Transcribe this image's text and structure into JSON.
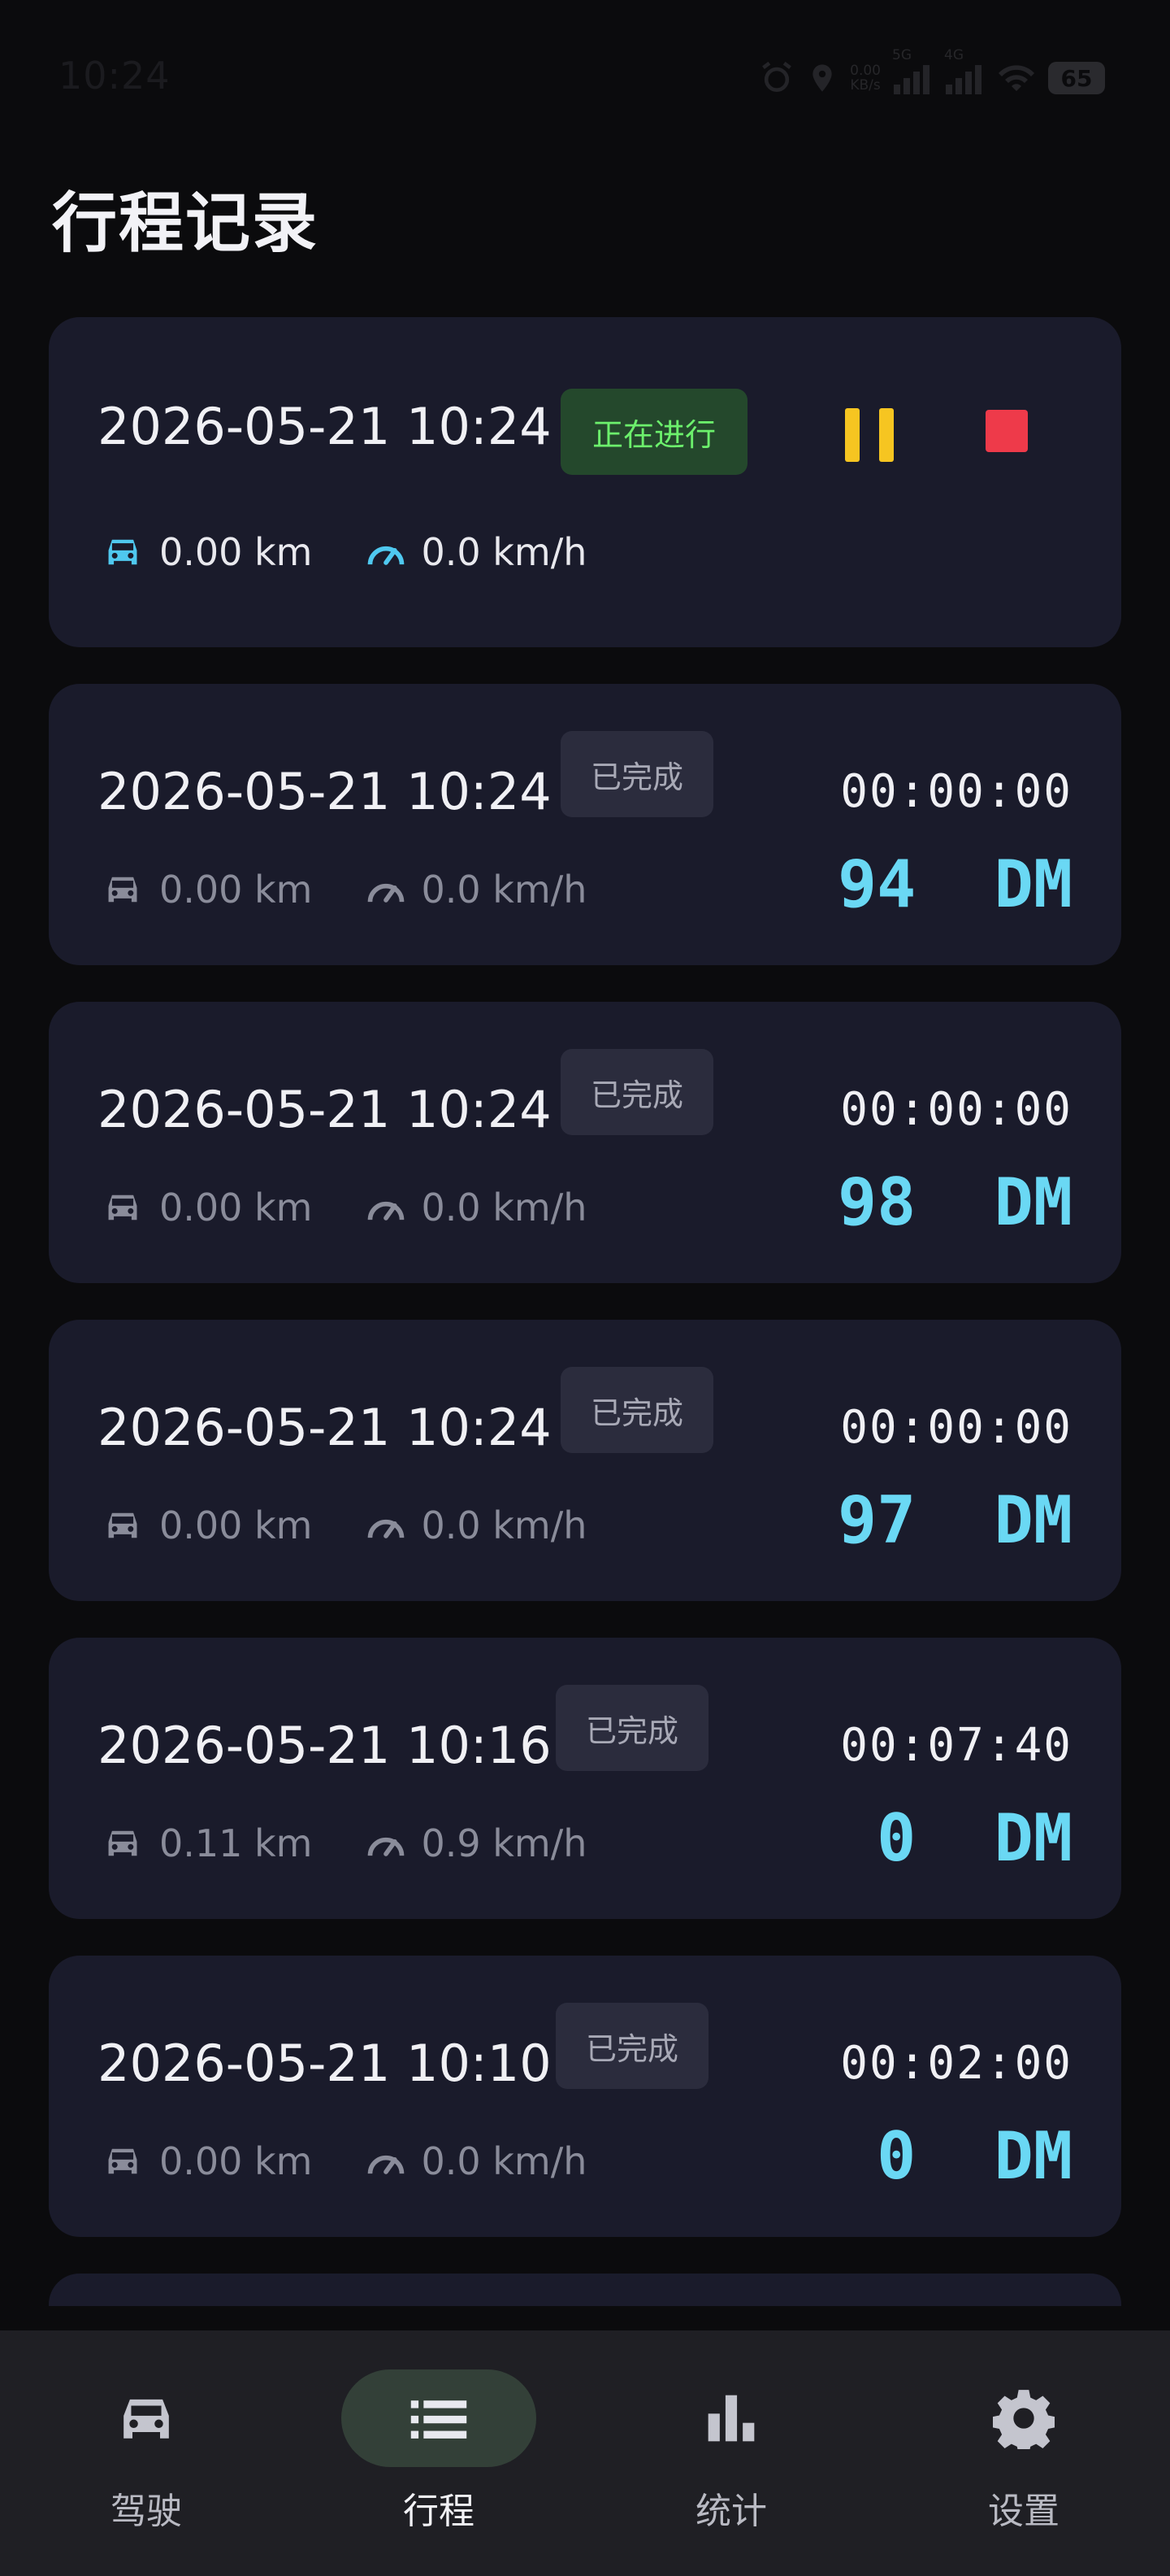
{
  "status": {
    "time": "10:24",
    "net_speed_value": "0.00",
    "net_speed_unit": "KB/s",
    "signal1": "5G",
    "signal2": "4G",
    "battery": "65"
  },
  "page_title": "行程记录",
  "active_trip": {
    "time": "2026-05-21 10:24",
    "badge": "正在进行",
    "distance": "0.00 km",
    "speed": "0.0 km/h",
    "colors": {
      "pause": "#f6c521",
      "stop": "#ee3a4a",
      "icon": "#4fc8ef"
    }
  },
  "trips": [
    {
      "time": "2026-05-21 10:24",
      "badge": "已完成",
      "distance": "0.00 km",
      "speed": "0.0 km/h",
      "duration": "00:00:00",
      "score": "94  DM"
    },
    {
      "time": "2026-05-21 10:24",
      "badge": "已完成",
      "distance": "0.00 km",
      "speed": "0.0 km/h",
      "duration": "00:00:00",
      "score": "98  DM"
    },
    {
      "time": "2026-05-21 10:24",
      "badge": "已完成",
      "distance": "0.00 km",
      "speed": "0.0 km/h",
      "duration": "00:00:00",
      "score": "97  DM"
    },
    {
      "time": "2026-05-21 10:16",
      "badge": "已完成",
      "distance": "0.11 km",
      "speed": "0.9 km/h",
      "duration": "00:07:40",
      "score": "0  DM"
    },
    {
      "time": "2026-05-21 10:10",
      "badge": "已完成",
      "distance": "0.00 km",
      "speed": "0.0 km/h",
      "duration": "00:02:00",
      "score": "0  DM"
    }
  ],
  "nav": [
    {
      "label": "驾驶",
      "icon": "car-icon"
    },
    {
      "label": "行程",
      "icon": "list-icon",
      "selected": true
    },
    {
      "label": "统计",
      "icon": "bar-chart-icon"
    },
    {
      "label": "设置",
      "icon": "gear-icon"
    }
  ]
}
